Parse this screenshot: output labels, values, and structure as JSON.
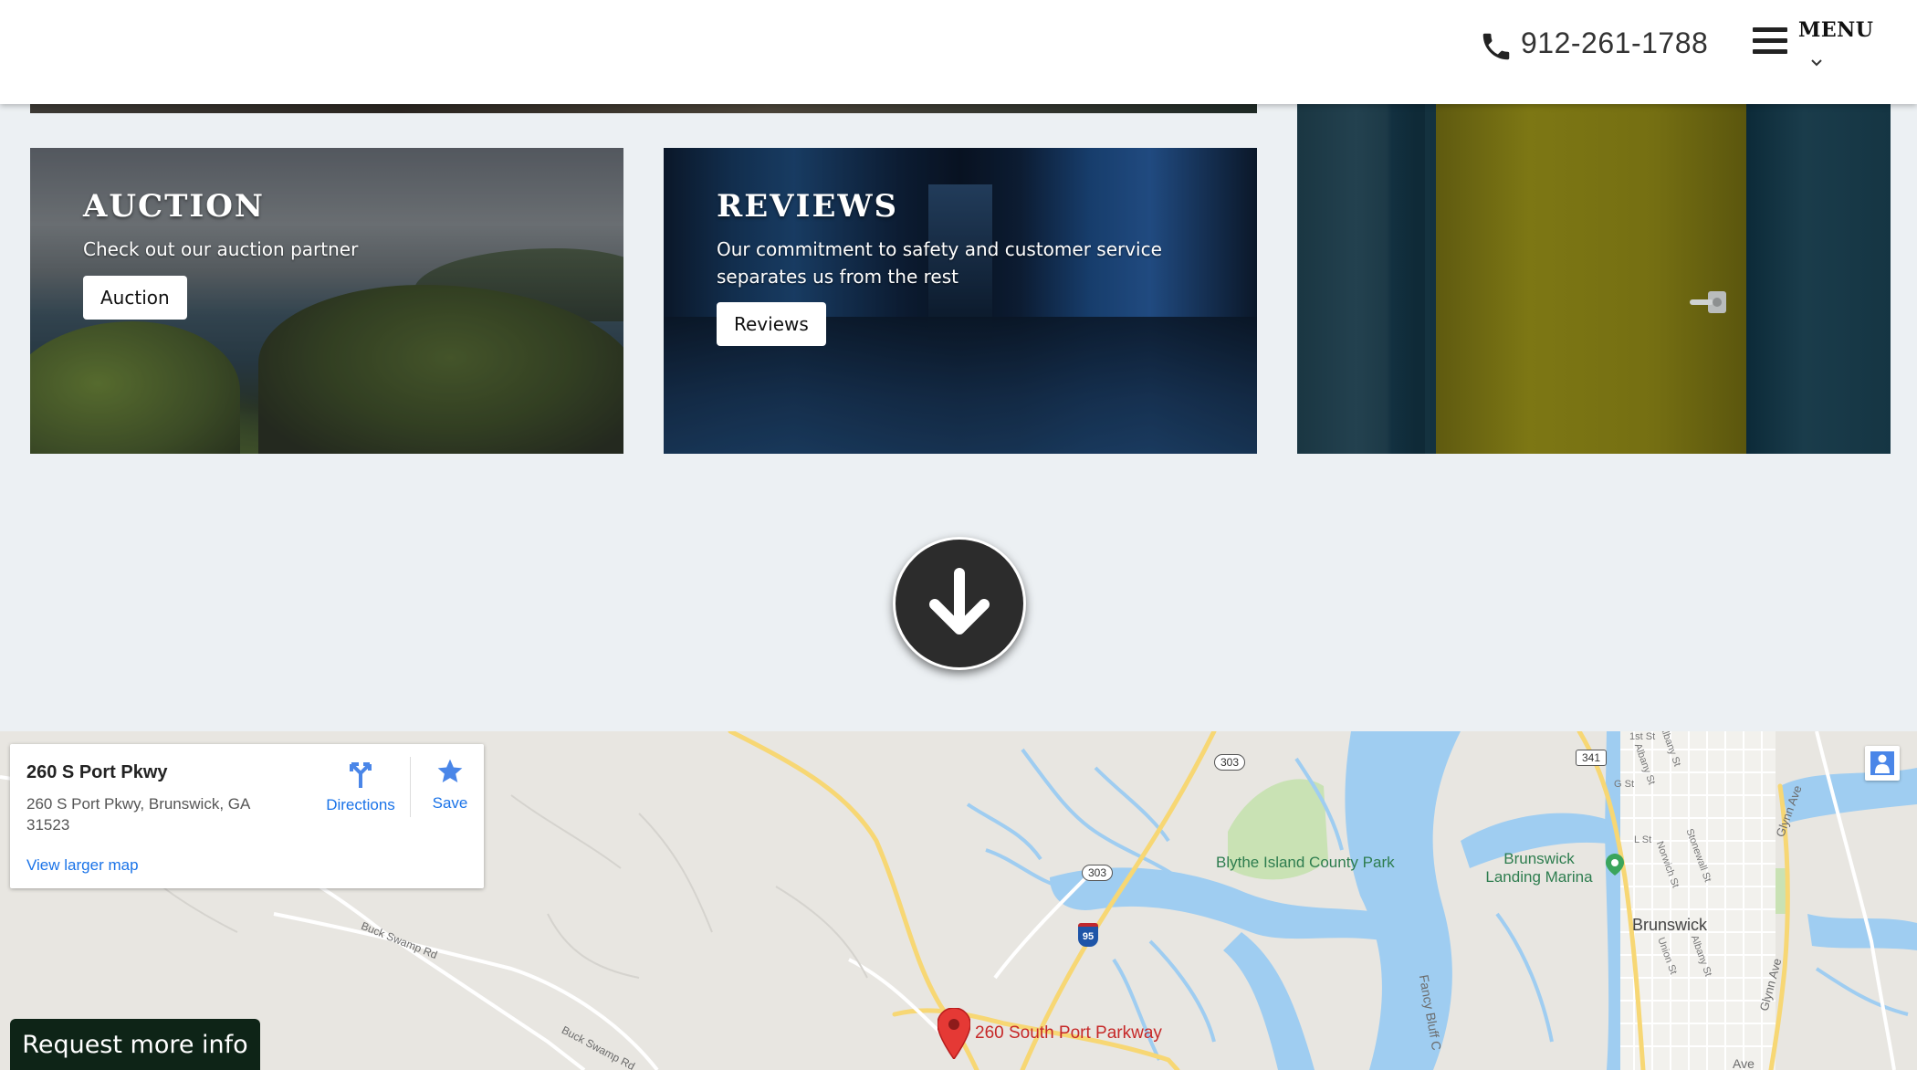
{
  "header": {
    "phone": "912-261-1788",
    "phone_icon": "phone-icon",
    "menu_label": "MENU",
    "menu_icon": "hamburger-icon"
  },
  "cards": [
    {
      "title": "AUCTION",
      "subtitle": "Check out our auction partner",
      "button": "Auction"
    },
    {
      "title": "REVIEWS",
      "subtitle": "Our commitment to safety and customer service separates us from the rest",
      "button": "Reviews"
    }
  ],
  "scroll_icon": "arrow-down-icon",
  "map": {
    "place_title": "260 S Port Pkwy",
    "place_address": "260 S Port Pkwy, Brunswick, GA 31523",
    "directions_label": "Directions",
    "save_label": "Save",
    "larger_map_label": "View larger map",
    "marker_label": "260 South Port Parkway",
    "labels": {
      "park": "Blythe Island County Park",
      "marina": "Brunswick Landing Marina",
      "city": "Brunswick",
      "road1": "Buck Swamp Rd",
      "road2": "Buck Swamp Rd",
      "river": "Fancy Bluff C",
      "glynn1": "Glynn Ave",
      "glynn2": "Glynn Ave",
      "ave": "Ave",
      "hwy303a": "303",
      "hwy303b": "303",
      "hwy341": "341",
      "i95": "95",
      "streets": [
        "Albany St",
        "Albany St",
        "Norwich St",
        "Stonewall St",
        "Union St",
        "Albany St",
        "1st St",
        "G St",
        "L St"
      ]
    }
  },
  "request_button": "Request more info",
  "colors": {
    "background": "#ecf0f3",
    "map_link": "#1a73e8",
    "request_bg": "#0e2417"
  }
}
